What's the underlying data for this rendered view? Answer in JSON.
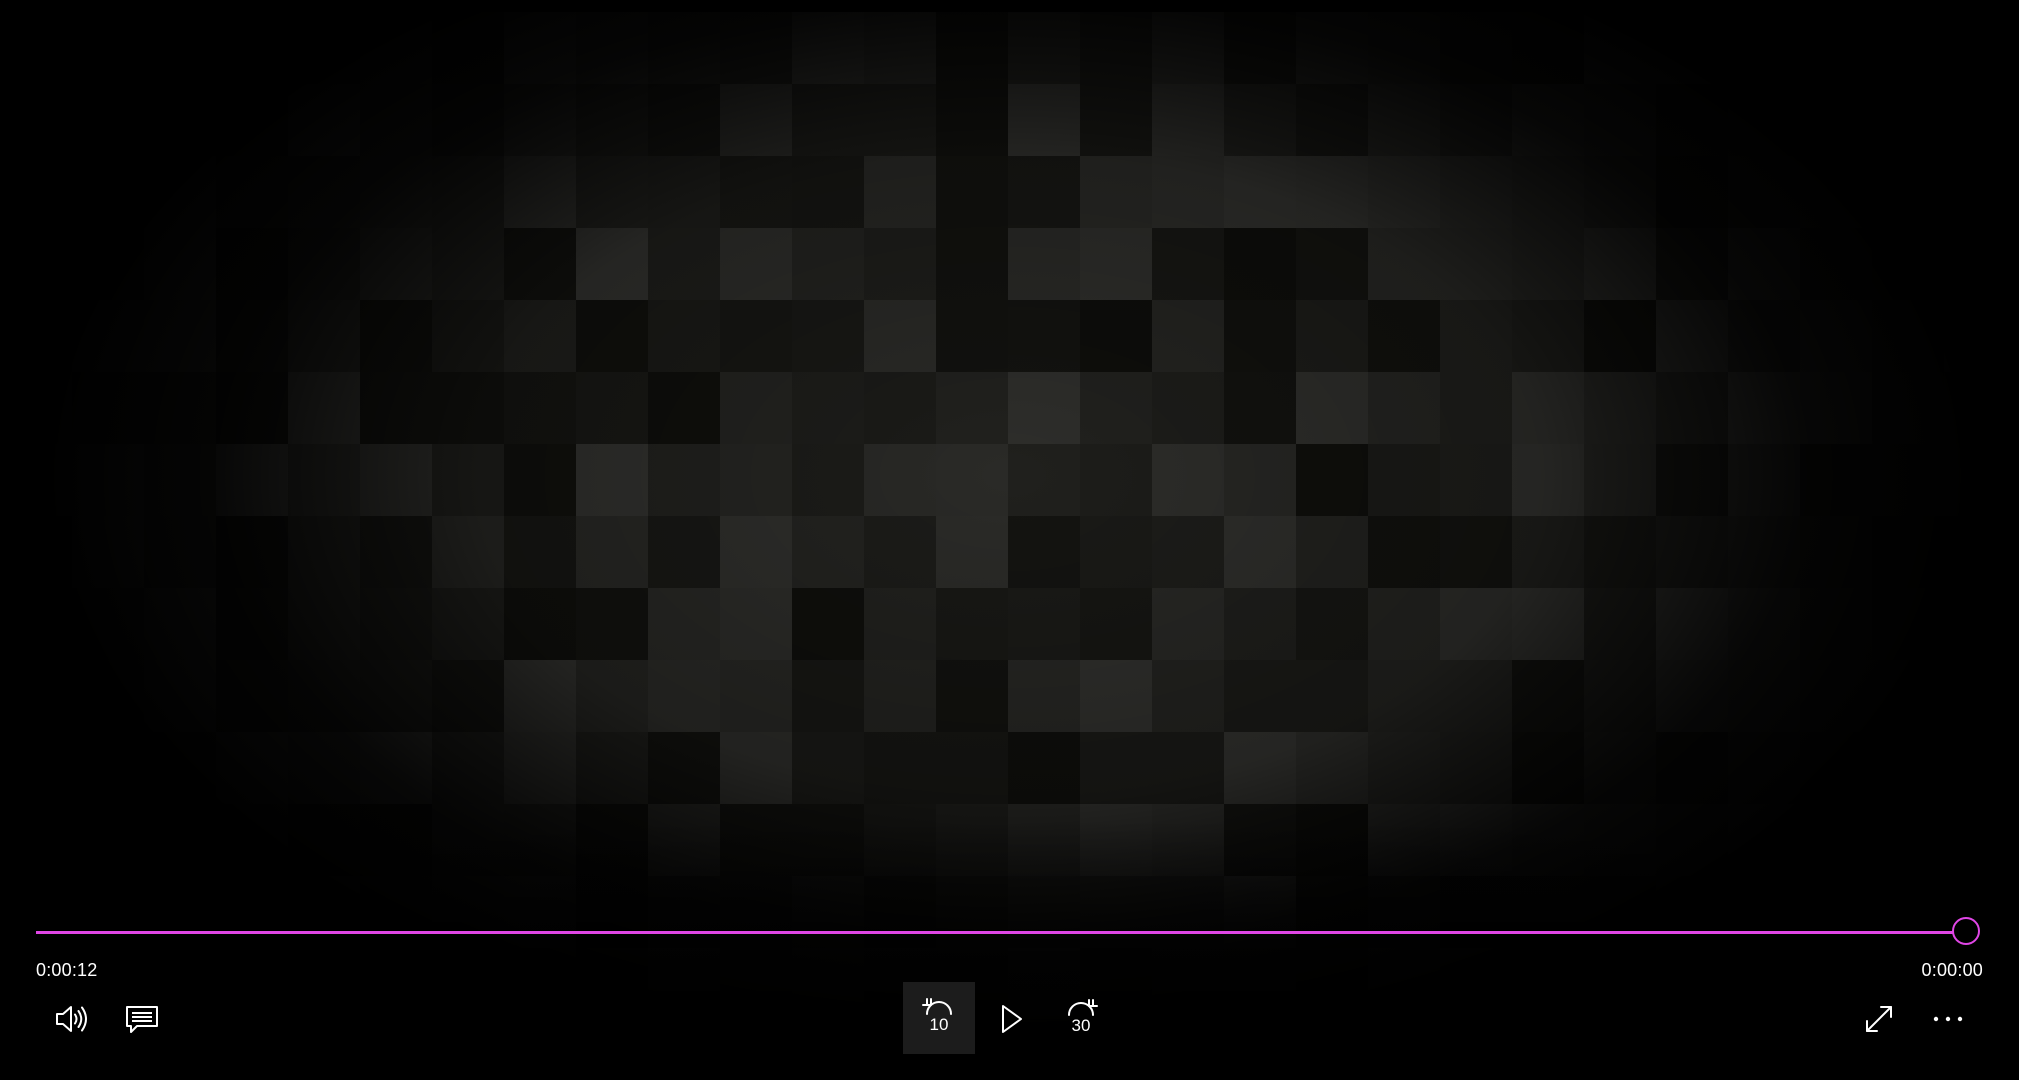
{
  "playback": {
    "elapsed_time": "0:00:12",
    "remaining_time": "0:00:00",
    "progress_fraction": 1.0
  },
  "controls": {
    "left": [
      {
        "name": "volume-button",
        "icon": "volume-icon"
      },
      {
        "name": "captions-button",
        "icon": "captions-icon"
      }
    ],
    "center": {
      "skip_back_label": "10",
      "skip_back_icon": "skip-back-icon",
      "play_icon": "play-icon",
      "skip_forward_label": "30",
      "skip_forward_icon": "skip-forward-icon"
    },
    "right": [
      {
        "name": "fullscreen-button",
        "icon": "fullscreen-icon"
      },
      {
        "name": "more-options-button",
        "icon": "more-icon"
      }
    ]
  },
  "colors": {
    "accent": "#e046e6",
    "background": "#000000",
    "text": "#ffffff"
  }
}
